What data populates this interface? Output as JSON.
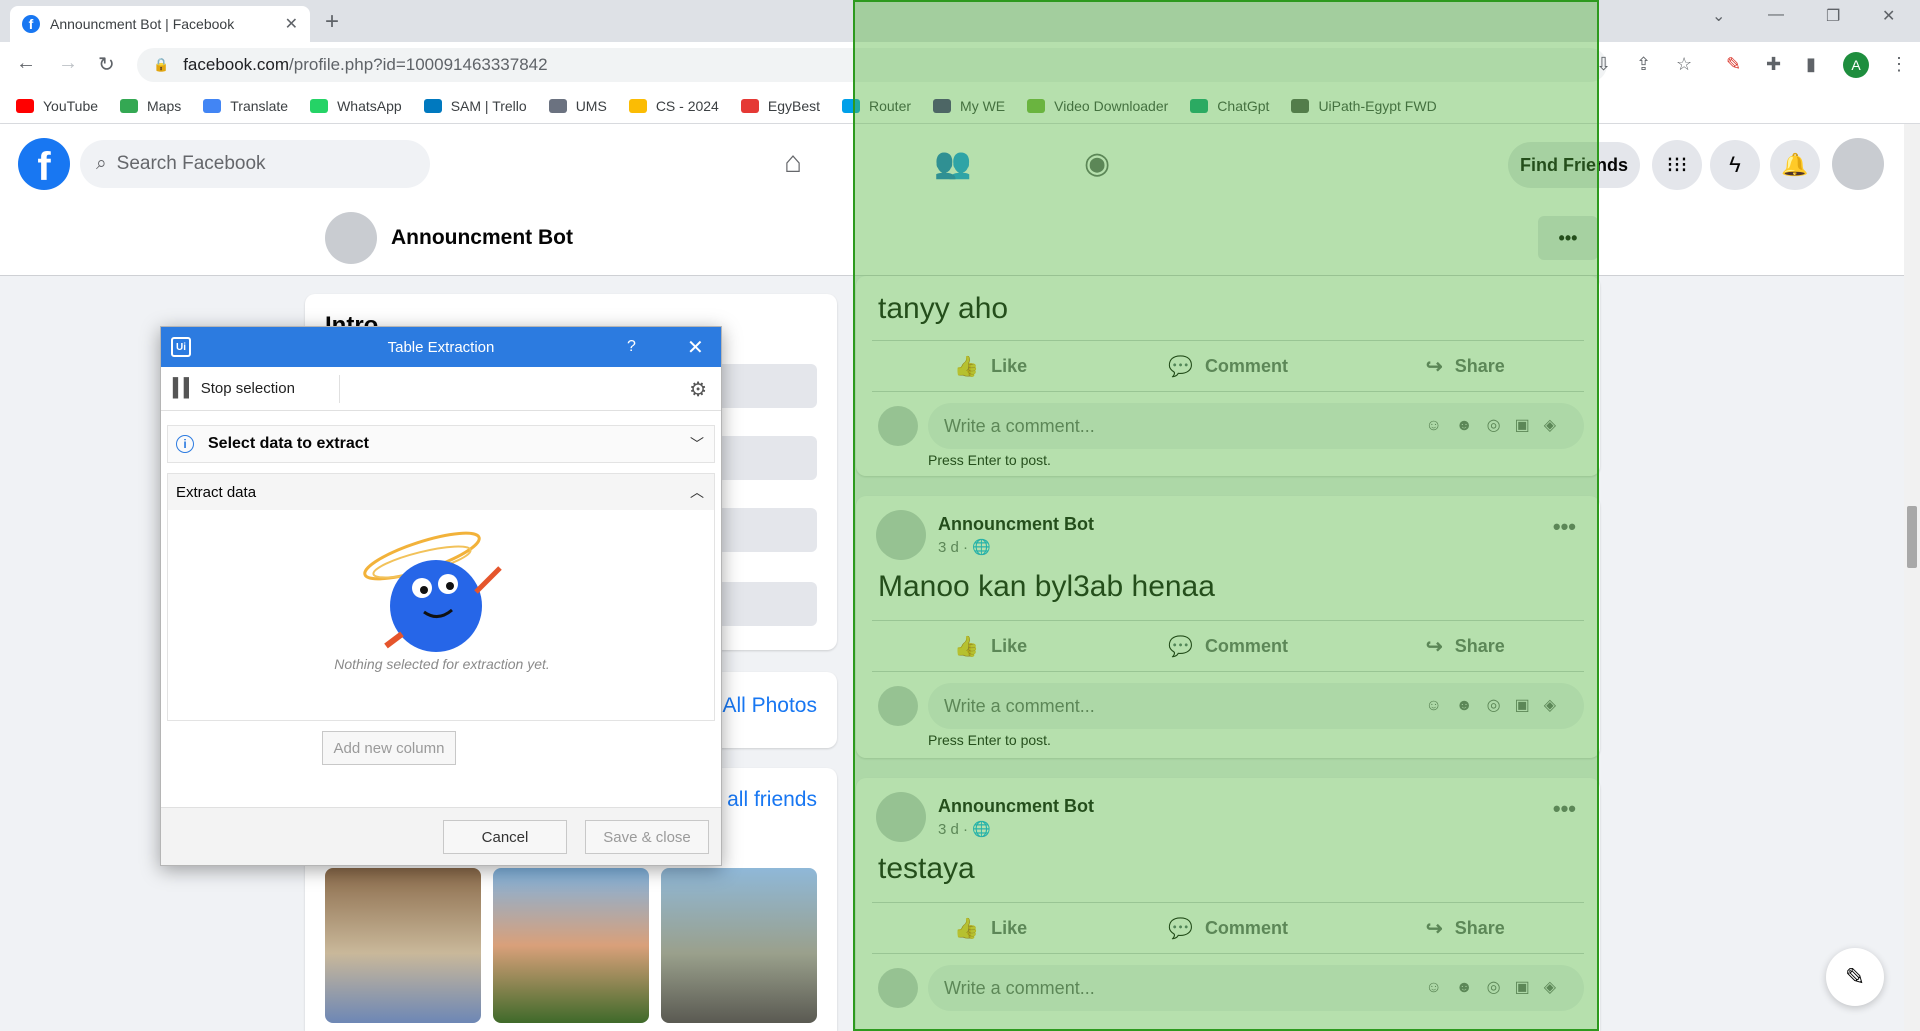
{
  "browser": {
    "tab_title": "Announcment Bot | Facebook",
    "url_host": "facebook.com",
    "url_path": "/profile.php?id=100091463337842",
    "profile_initial": "A",
    "bookmarks": [
      {
        "label": "YouTube",
        "color": "#ff0000"
      },
      {
        "label": "Maps",
        "color": "#34a853"
      },
      {
        "label": "Translate",
        "color": "#4285f4"
      },
      {
        "label": "WhatsApp",
        "color": "#25d366"
      },
      {
        "label": "SAM | Trello",
        "color": "#0079bf"
      },
      {
        "label": "UMS",
        "color": "#6b7280"
      },
      {
        "label": "CS - 2024",
        "color": "#fbbc04"
      },
      {
        "label": "EgyBest",
        "color": "#e53935"
      },
      {
        "label": "Router",
        "color": "#00a0e9"
      },
      {
        "label": "My WE",
        "color": "#4b2e83"
      },
      {
        "label": "Video Downloader",
        "color": "#7cb342"
      },
      {
        "label": "ChatGpt",
        "color": "#10a37f"
      },
      {
        "label": "UiPath-Egypt FWD",
        "color": "#555555"
      }
    ]
  },
  "facebook": {
    "search_placeholder": "Search Facebook",
    "find_friends": "Find Friends",
    "profile_name": "Announcment Bot",
    "intro_heading": "Intro",
    "all_photos": "All Photos",
    "all_friends": "all friends"
  },
  "posts": [
    {
      "text": "tanyy aho"
    },
    {
      "author": "Announcment Bot",
      "meta": "3 d · ",
      "text": "Manoo kan byl3ab henaa"
    },
    {
      "author": "Announcment Bot",
      "meta": "3 d · ",
      "text": "testaya"
    }
  ],
  "post_actions": {
    "like": "Like",
    "comment": "Comment",
    "share": "Share"
  },
  "comment": {
    "placeholder": "Write a comment...",
    "hint": "Press Enter to post."
  },
  "dialog": {
    "title": "Table Extraction",
    "stop_selection": "Stop selection",
    "select_data": "Select data to extract",
    "extract_data": "Extract data",
    "empty_message": "Nothing selected for extraction yet.",
    "add_column": "Add new column",
    "cancel": "Cancel",
    "save_close": "Save & close"
  },
  "colors": {
    "facebook_blue": "#1877f2",
    "uipath_blue": "#2c7be0",
    "selection_green": "#2d9a1e"
  }
}
